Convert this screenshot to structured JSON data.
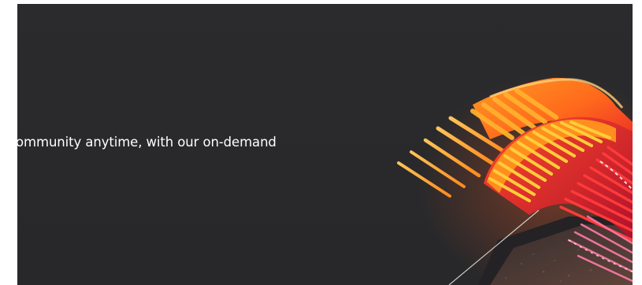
{
  "hero": {
    "text": "ommunity anytime, with our on-demand"
  },
  "colors": {
    "background": "#2a2a2c",
    "text": "#ffffff",
    "accent_orange": "#ff8a1e",
    "accent_red": "#e8202a",
    "accent_yellow": "#ffb52e"
  },
  "graphic": {
    "icon": "orange-red-3d-ribbon-artwork"
  }
}
